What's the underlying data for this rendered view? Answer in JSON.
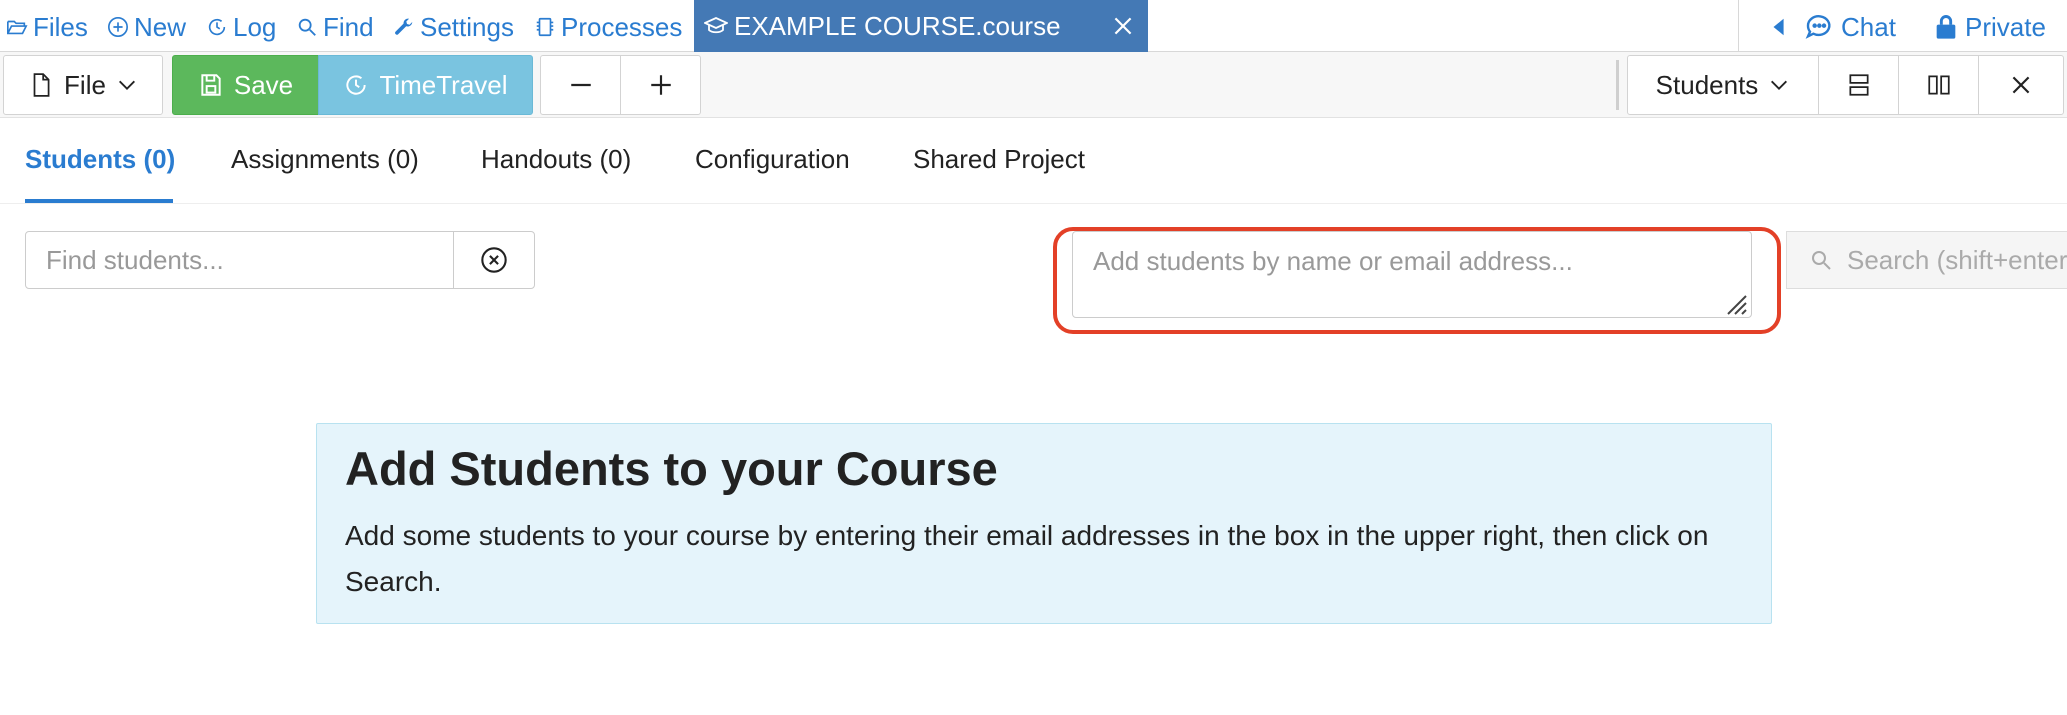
{
  "topnav": {
    "files": "Files",
    "new": "New",
    "log": "Log",
    "find": "Find",
    "settings": "Settings",
    "processes": "Processes",
    "active_tab": "EXAMPLE COURSE.course",
    "chat": "Chat",
    "private": "Private"
  },
  "toolbar": {
    "file": "File",
    "save": "Save",
    "timetravel": "TimeTravel",
    "frame_select": "Students"
  },
  "tabs": [
    {
      "label": "Students (0)",
      "active": true
    },
    {
      "label": "Assignments (0)"
    },
    {
      "label": "Handouts (0)"
    },
    {
      "label": "Configuration"
    },
    {
      "label": "Shared Project"
    }
  ],
  "search": {
    "find_placeholder": "Find students...",
    "add_placeholder": "Add students by name or email address...",
    "search_button": "Search (shift+enter)"
  },
  "info": {
    "title": "Add Students to your Course",
    "body": "Add some students to your course by entering their email addresses in the box in the upper right, then click on Search."
  },
  "colors": {
    "link": "#2a7cd0",
    "active_tab_bg": "#4479b5",
    "save_bg": "#5cb85c",
    "timetravel_bg": "#7ac4e0",
    "highlight": "#e34027",
    "info_bg": "#e5f4fb"
  }
}
